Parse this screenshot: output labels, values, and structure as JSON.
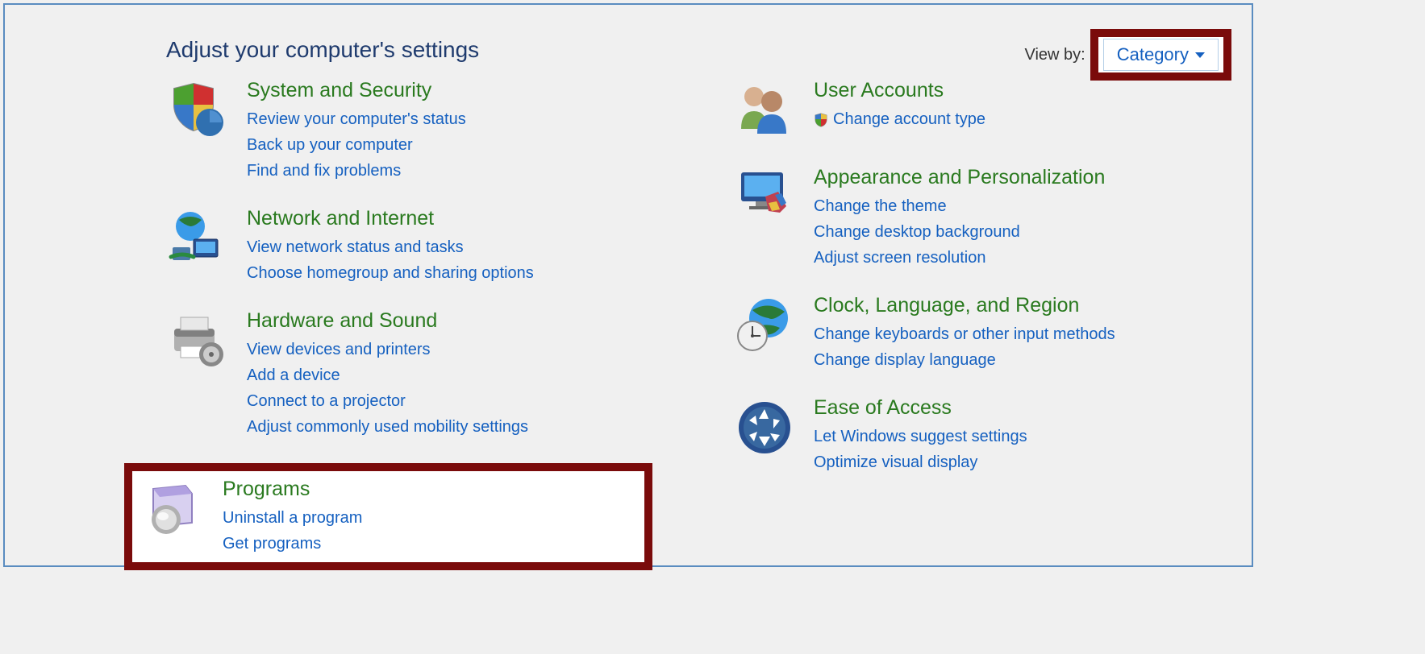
{
  "header": {
    "title": "Adjust your computer's settings",
    "view_by_label": "View by:",
    "view_by_value": "Category"
  },
  "left": {
    "system_security": {
      "title": "System and Security",
      "links": [
        "Review your computer's status",
        "Back up your computer",
        "Find and fix problems"
      ]
    },
    "network": {
      "title": "Network and Internet",
      "links": [
        "View network status and tasks",
        "Choose homegroup and sharing options"
      ]
    },
    "hardware": {
      "title": "Hardware and Sound",
      "links": [
        "View devices and printers",
        "Add a device",
        "Connect to a projector",
        "Adjust commonly used mobility settings"
      ]
    },
    "programs": {
      "title": "Programs",
      "links": [
        "Uninstall a program",
        "Get programs"
      ]
    }
  },
  "right": {
    "user_accounts": {
      "title": "User Accounts",
      "links": [
        "Change account type"
      ]
    },
    "appearance": {
      "title": "Appearance and Personalization",
      "links": [
        "Change the theme",
        "Change desktop background",
        "Adjust screen resolution"
      ]
    },
    "clock": {
      "title": "Clock, Language, and Region",
      "links": [
        "Change keyboards or other input methods",
        "Change display language"
      ]
    },
    "ease": {
      "title": "Ease of Access",
      "links": [
        "Let Windows suggest settings",
        "Optimize visual display"
      ]
    }
  }
}
